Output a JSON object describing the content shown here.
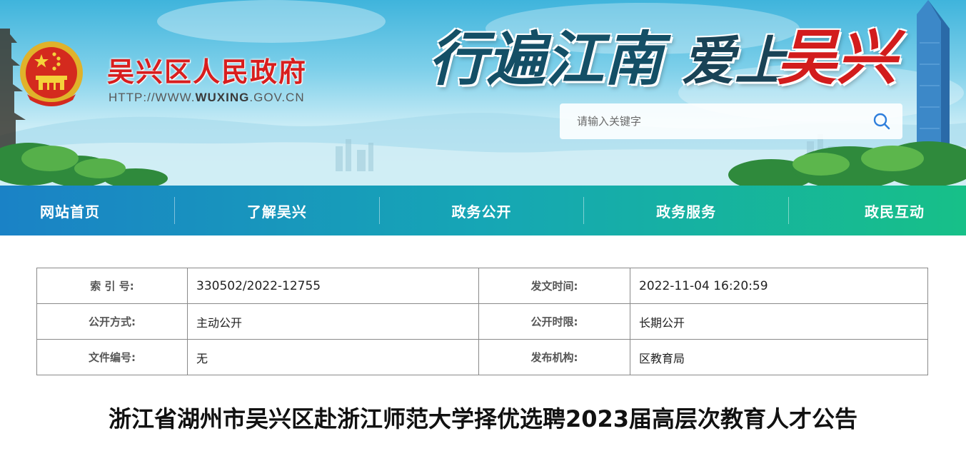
{
  "header": {
    "site_name": "吴兴区人民政府",
    "site_url_prefix": "HTTP://WWW.",
    "site_url_bold": "WUXING",
    "site_url_suffix": ".GOV.CN",
    "slogan_part1": "行遍江南",
    "slogan_part2": "爱上",
    "slogan_part3": "吴兴",
    "search_placeholder": "请输入关键字"
  },
  "nav": {
    "items": [
      {
        "label": "网站首页"
      },
      {
        "label": "了解吴兴"
      },
      {
        "label": "政务公开"
      },
      {
        "label": "政务服务"
      },
      {
        "label": "政民互动"
      }
    ]
  },
  "meta_table": {
    "rows": [
      {
        "label1": "索 引 号:",
        "value1": "330502/2022-12755",
        "label2": "发文时间:",
        "value2": "2022-11-04 16:20:59"
      },
      {
        "label1": "公开方式:",
        "value1": "主动公开",
        "label2": "公开时限:",
        "value2": "长期公开"
      },
      {
        "label1": "文件编号:",
        "value1": "无",
        "label2": "发布机构:",
        "value2": "区教育局"
      }
    ]
  },
  "article": {
    "title": "浙江省湖州市吴兴区赴浙江师范大学择优选聘2023届高层次教育人才公告"
  },
  "colors": {
    "site_name_red": "#d81e1e",
    "nav_gradient_start": "#1a82c6",
    "nav_gradient_end": "#17c088",
    "search_icon_blue": "#2f7fdc"
  },
  "icons": {
    "emblem": "national-emblem-icon",
    "search": "search-icon"
  }
}
